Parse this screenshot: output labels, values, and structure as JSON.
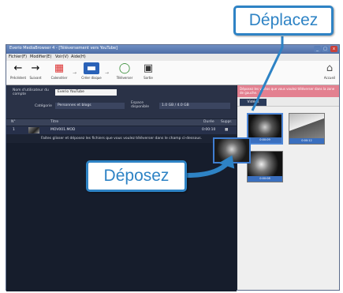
{
  "window": {
    "title": "Everio MediaBrowser 4 - [Téléversement vers YouTube]",
    "buttons": [
      "_",
      "□",
      "x"
    ]
  },
  "menu": [
    "Fichier(F)",
    "Modifier(E)",
    "Voir(V)",
    "Aide(H)"
  ],
  "toolbar": {
    "items": [
      {
        "label": "Précédent",
        "icon": "arrow-left-icon"
      },
      {
        "label": "Suivant",
        "icon": "arrow-right-icon"
      },
      {
        "label": "Calendrier",
        "icon": "calendar-icon"
      },
      {
        "label": "Créer disque",
        "icon": "disc-icon"
      },
      {
        "label": "Téléverser",
        "icon": "upload-icon"
      },
      {
        "label": "Sortie",
        "icon": "exit-icon"
      }
    ],
    "home_label": "Accueil"
  },
  "info": {
    "account_label": "Nom d'utilisateur du compte",
    "account_value": "Everio YouTube",
    "category_label": "Catégorie",
    "category_value": "Personnes et blogs",
    "space_label": "Espace disponible",
    "space_value": "1.0 GB / 4.0 GB"
  },
  "list": {
    "headers": [
      "N°",
      "Titre",
      "Durée",
      "Suppr."
    ],
    "rows": [
      {
        "num": "1",
        "title": "MOV001.MOD",
        "duration": "0:00:10"
      }
    ],
    "hint": "Faites glisser et déposez les fichiers que vous voulez téléverser dans le champ ci-dessous."
  },
  "right_panel": {
    "header": "Déposez les vidéos que vous voulez téléverser dans la zone de gauche.",
    "tab": "Vidéos",
    "thumbs": [
      {
        "caption": "0:00:09",
        "selected": true
      },
      {
        "caption": "0:00:12",
        "selected": false
      },
      {
        "caption": "0:00:08",
        "selected": false
      }
    ]
  },
  "callouts": {
    "move": "Déplacez",
    "drop": "Déposez"
  },
  "colors": {
    "accent": "#2e83c5",
    "panel_header": "#e38090",
    "app_bg": "#1c2333"
  }
}
